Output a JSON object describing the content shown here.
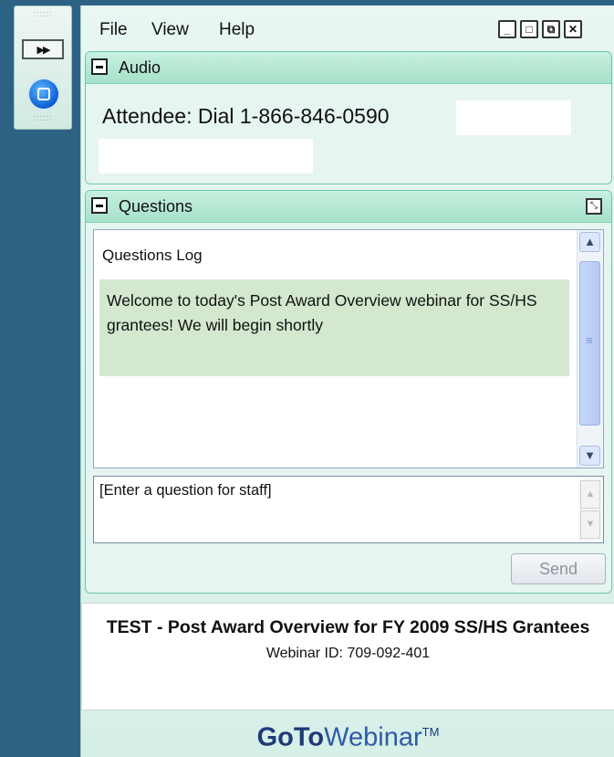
{
  "menu": {
    "file": "File",
    "view": "View",
    "help": "Help"
  },
  "window_controls": {
    "minimize": "_",
    "maximize": "□",
    "restore": "⧉",
    "close": "✕"
  },
  "audio": {
    "title": "Audio",
    "dial_text": "Attendee: Dial 1-866-846-0590"
  },
  "questions": {
    "title": "Questions",
    "log_title": "Questions Log",
    "welcome_message": "Welcome to today's Post Award Overview webinar for SS/HS grantees! We will begin shortly",
    "input_text": "[Enter a question for staff]",
    "send_label": "Send"
  },
  "webinar": {
    "title": "TEST - Post Award Overview for FY 2009 SS/HS Grantees",
    "id_text": "Webinar ID: 709-092-401"
  },
  "brand": {
    "goto": "GoTo",
    "webinar": "Webinar",
    "tm": "TM"
  },
  "colors": {
    "background": "#2e6282",
    "panel": "#e6f5f0",
    "section_header": "#a6e1ca",
    "message_bubble": "#d3e8cf",
    "brand": "#1e3a78"
  }
}
